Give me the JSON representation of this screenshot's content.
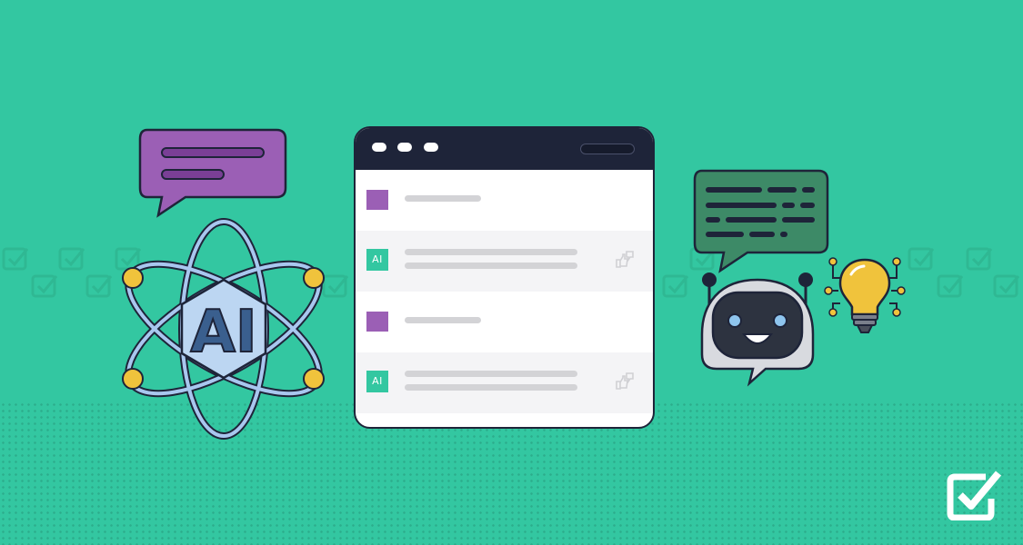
{
  "hero": {
    "atom_label": "AI"
  },
  "chat_window": {
    "rows": [
      {
        "role": "user"
      },
      {
        "role": "ai",
        "avatar_label": "AI"
      },
      {
        "role": "user"
      },
      {
        "role": "ai",
        "avatar_label": "AI"
      }
    ]
  },
  "colors": {
    "background": "#33c7a1",
    "window_titlebar": "#1e2439",
    "user_avatar": "#9b5fb5",
    "ai_avatar": "#33c7a1",
    "speech_bubble_left": "#9b5fb5",
    "speech_bubble_right": "#3d8a67",
    "lightbulb": "#f0c33c",
    "atom_orbit": "#a9c7ef"
  },
  "icons": [
    "chat-bubble-icon",
    "atom-ai-icon",
    "robot-icon",
    "lightbulb-icon",
    "thumbs-feedback-icon",
    "checkbox-logo-icon"
  ]
}
